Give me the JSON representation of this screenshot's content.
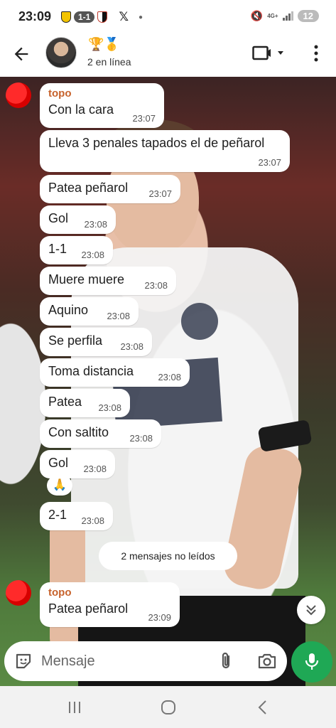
{
  "status_bar": {
    "time": "23:09",
    "score": "1-1",
    "network": "4G+",
    "battery": "12"
  },
  "header": {
    "title_emojis": "🏆🥇",
    "subtitle": "2 en línea"
  },
  "messages": [
    {
      "sender": "topo",
      "text": "Con la cara",
      "time": "23:07"
    },
    {
      "text": "Lleva 3 penales tapados el de peñarol",
      "time": "23:07"
    },
    {
      "text": "Patea peñarol",
      "time": "23:07"
    },
    {
      "text": "Gol",
      "time": "23:08"
    },
    {
      "text": "1-1",
      "time": "23:08"
    },
    {
      "text": "Muere muere",
      "time": "23:08"
    },
    {
      "text": "Aquino",
      "time": "23:08"
    },
    {
      "text": "Se perfila",
      "time": "23:08"
    },
    {
      "text": "Toma distancia",
      "time": "23:08"
    },
    {
      "text": "Patea",
      "time": "23:08"
    },
    {
      "text": "Con saltito",
      "time": "23:08"
    },
    {
      "text": "Gol",
      "time": "23:08",
      "reaction": "🙏"
    },
    {
      "text": "2-1",
      "time": "23:08"
    },
    {
      "sender": "topo",
      "text": "Patea peñarol",
      "time": "23:09"
    }
  ],
  "unread_label": "2 mensajes no leídos",
  "composer": {
    "placeholder": "Mensaje"
  },
  "colors": {
    "sender": "#c7622c",
    "send_button": "#1fa855",
    "bubble": "#ffffff"
  }
}
